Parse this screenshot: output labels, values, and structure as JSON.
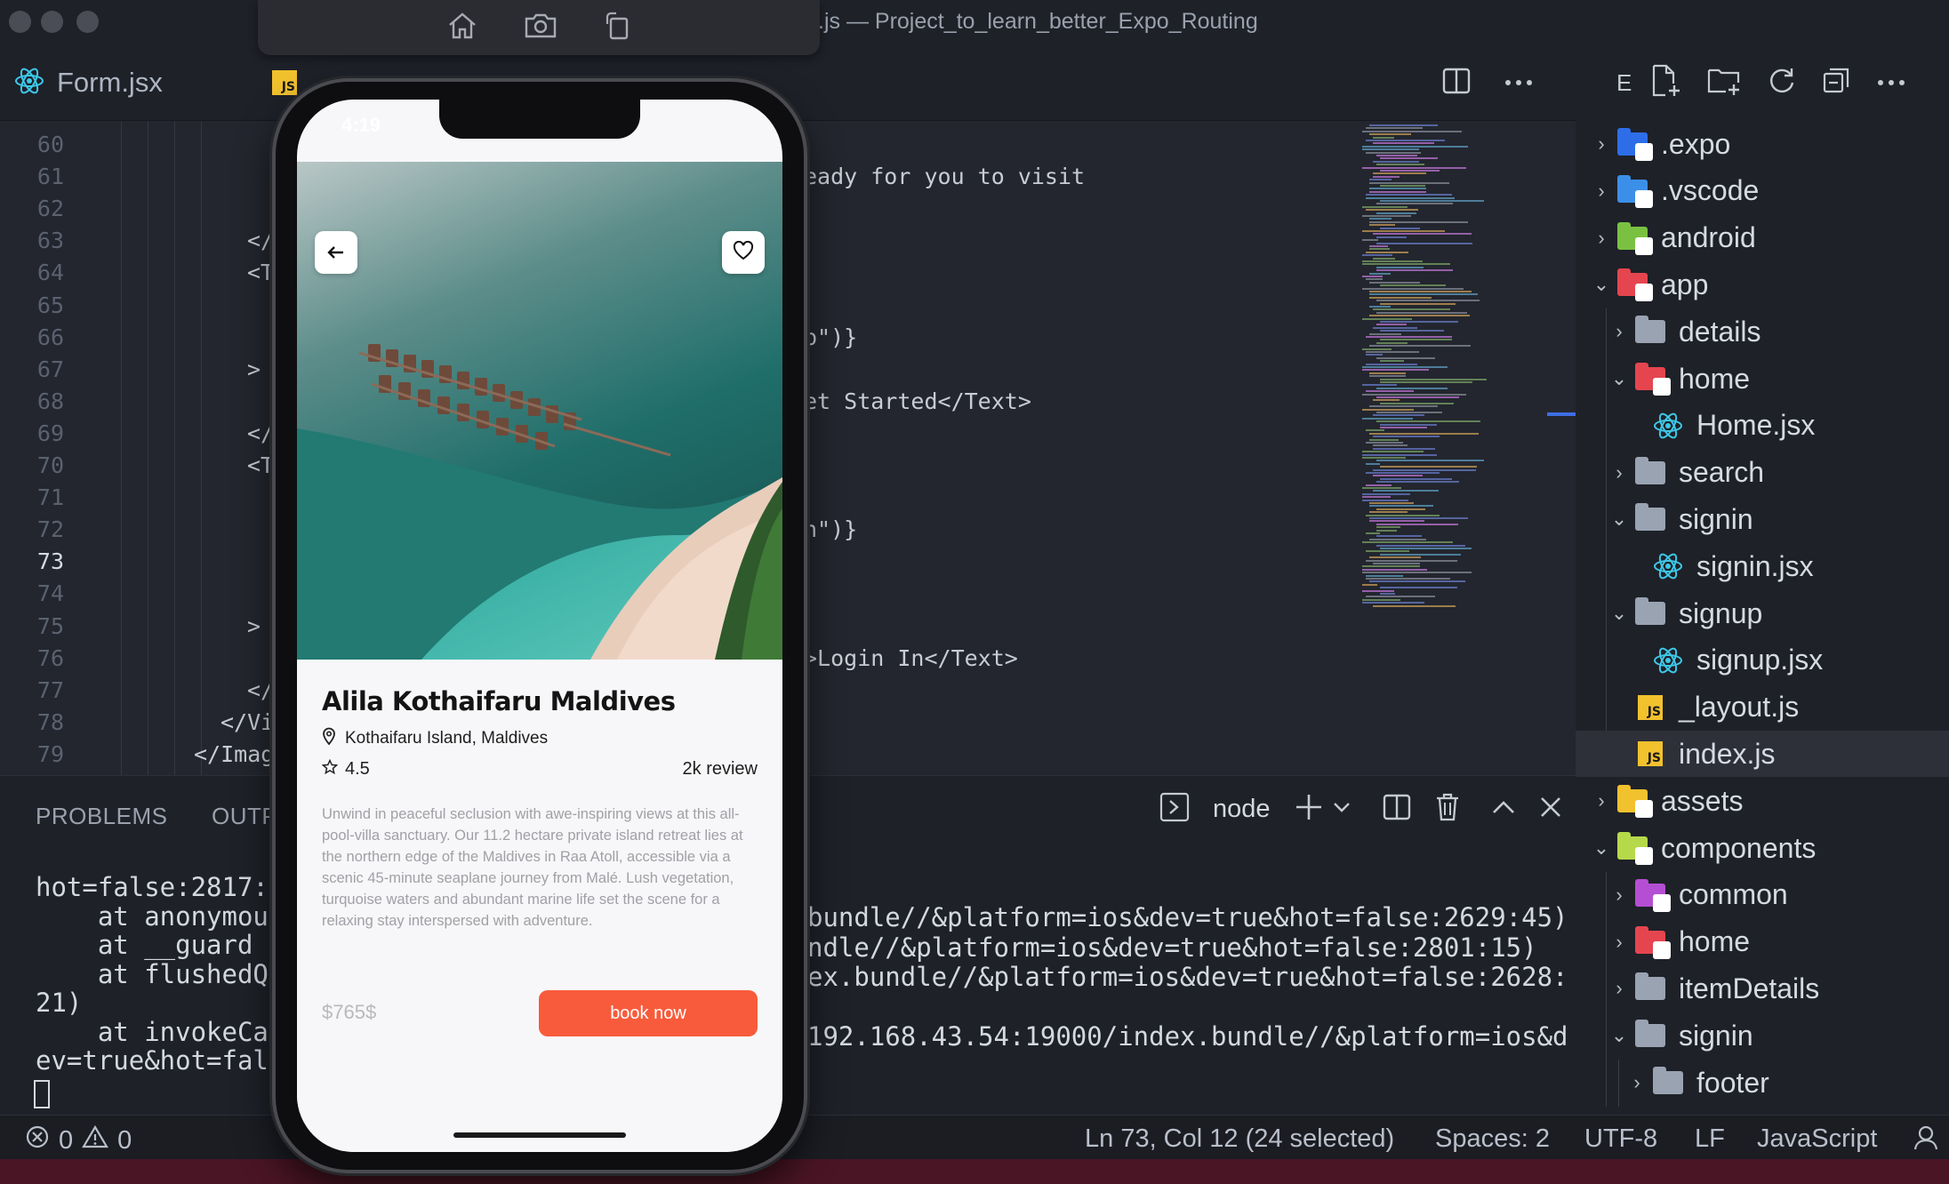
{
  "window": {
    "title": ".js — Project_to_learn_better_Expo_Routing"
  },
  "tabs": [
    {
      "label": "Form.jsx"
    },
    {
      "label": "index.js"
    }
  ],
  "editor": {
    "line_numbers": [
      "60",
      "61",
      "62",
      "63",
      "64",
      "65",
      "66",
      "67",
      "68",
      "69",
      "70",
      "71",
      "72",
      "73",
      "74",
      "75",
      "76",
      "77",
      "78",
      "79"
    ],
    "current_line": "73",
    "left_fragments": [
      {
        "line": "63",
        "text": "</"
      },
      {
        "line": "64",
        "text": "<T"
      },
      {
        "line": "67",
        "text": ">"
      },
      {
        "line": "69",
        "text": "</"
      },
      {
        "line": "70",
        "text": "<T"
      },
      {
        "line": "75",
        "text": ">"
      },
      {
        "line": "77",
        "text": "</"
      },
      {
        "line": "78",
        "text": "</Vi"
      },
      {
        "line": "79",
        "text": "</Imag"
      }
    ],
    "right_fragments": [
      {
        "line": "61",
        "text": "eady for you to visit"
      },
      {
        "line": "66",
        "text": "p\")}"
      },
      {
        "line": "68",
        "text": "et Started</Text>"
      },
      {
        "line": "72",
        "text": "n\")}"
      },
      {
        "line": "76",
        "text": ">Login In</Text>"
      }
    ]
  },
  "panel": {
    "tabs": [
      "PROBLEMS",
      "OUTP"
    ],
    "terminal_label": "node",
    "left_lines": [
      "hot=false:2817:4",
      "    at anonymous",
      "    at __guard (",
      "    at flushedQu",
      "21)",
      "    at invokeCal",
      "ev=true&hot=fals"
    ],
    "right_lines": [
      "bundle//&platform=ios&dev=true&hot=false:2629:45)",
      "ndle//&platform=ios&dev=true&hot=false:2801:15)",
      "ex.bundle//&platform=ios&dev=true&hot=false:2628:",
      "",
      "192.168.43.54:19000/index.bundle//&platform=ios&d"
    ]
  },
  "status": {
    "errors": "0",
    "warnings": "0",
    "position": "Ln 73, Col 12 (24 selected)",
    "spaces": "Spaces: 2",
    "encoding": "UTF-8",
    "eol": "LF",
    "language": "JavaScript"
  },
  "explorer": {
    "header_letter": "E",
    "items": [
      {
        "name": ".expo",
        "type": "folder",
        "chevron": "›",
        "icon": "expo-folder-icon",
        "color": "#2d6ee8"
      },
      {
        "name": ".vscode",
        "type": "folder",
        "chevron": "›",
        "icon": "vscode-folder-icon",
        "color": "#3c8fe8"
      },
      {
        "name": "android",
        "type": "folder",
        "chevron": "›",
        "icon": "android-folder-icon",
        "color": "#7ac142"
      },
      {
        "name": "app",
        "type": "folder",
        "chevron": "⌄",
        "icon": "app-folder-icon",
        "color": "#e5454f"
      },
      {
        "name": "details",
        "type": "folder",
        "chevron": "›",
        "icon": "folder-icon",
        "color": "#9aa3b2"
      },
      {
        "name": "home",
        "type": "folder",
        "chevron": "⌄",
        "icon": "home-folder-icon",
        "color": "#e5454f"
      },
      {
        "name": "Home.jsx",
        "type": "react",
        "chevron": "",
        "icon": "react-icon",
        "color": "#3ec8e8"
      },
      {
        "name": "search",
        "type": "folder",
        "chevron": "›",
        "icon": "folder-icon",
        "color": "#9aa3b2"
      },
      {
        "name": "signin",
        "type": "folder",
        "chevron": "⌄",
        "icon": "folder-open-icon",
        "color": "#9aa3b2"
      },
      {
        "name": "signin.jsx",
        "type": "react",
        "chevron": "",
        "icon": "react-icon",
        "color": "#3ec8e8"
      },
      {
        "name": "signup",
        "type": "folder",
        "chevron": "⌄",
        "icon": "folder-open-icon",
        "color": "#9aa3b2"
      },
      {
        "name": "signup.jsx",
        "type": "react",
        "chevron": "",
        "icon": "react-icon",
        "color": "#3ec8e8"
      },
      {
        "name": "_layout.js",
        "type": "js",
        "chevron": "",
        "icon": "js-file-icon",
        "color": "#f2c12e"
      },
      {
        "name": "index.js",
        "type": "js",
        "chevron": "",
        "icon": "js-file-icon",
        "color": "#f2c12e",
        "selected": true
      },
      {
        "name": "assets",
        "type": "folder",
        "chevron": "›",
        "icon": "assets-folder-icon",
        "color": "#f2c12e"
      },
      {
        "name": "components",
        "type": "folder",
        "chevron": "⌄",
        "icon": "components-folder-icon",
        "color": "#b6d94a"
      },
      {
        "name": "common",
        "type": "folder",
        "chevron": "›",
        "icon": "common-folder-icon",
        "color": "#b44fd4"
      },
      {
        "name": "home",
        "type": "folder",
        "chevron": "›",
        "icon": "home-folder-icon",
        "color": "#e5454f"
      },
      {
        "name": "itemDetails",
        "type": "folder",
        "chevron": "›",
        "icon": "folder-icon",
        "color": "#9aa3b2"
      },
      {
        "name": "signin",
        "type": "folder",
        "chevron": "⌄",
        "icon": "folder-open-icon",
        "color": "#9aa3b2"
      },
      {
        "name": "footer",
        "type": "folder",
        "chevron": "›",
        "icon": "folder-icon",
        "color": "#9aa3b2"
      }
    ]
  },
  "phone": {
    "status_time": "4:19",
    "hotel_name": "Alila Kothaifaru Maldives",
    "location": "Kothaifaru Island, Maldives",
    "rating": "4.5",
    "reviews": "2k review",
    "description": "Unwind in peaceful seclusion with awe-inspiring views at this all-pool-villa sanctuary. Our 11.2 hectare private island retreat lies at the northern edge of the Maldives in Raa Atoll, accessible via a scenic 45-minute seaplane journey from Malé. Lush vegetation, turquoise waters and abundant marine life set the scene for a relaxing stay interspersed with adventure.",
    "price": "$765$",
    "book_label": "book now",
    "accent": "#f85b3b"
  }
}
